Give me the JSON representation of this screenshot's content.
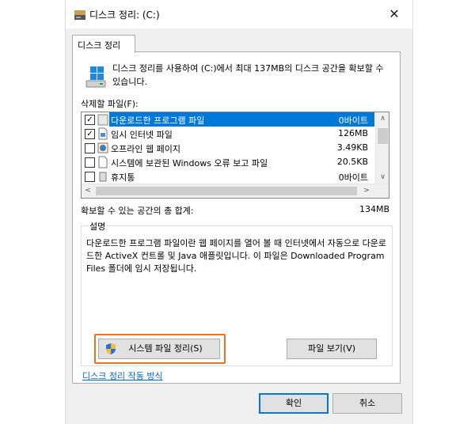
{
  "window": {
    "title": "디스크 정리: (C:)",
    "close_glyph": "✕"
  },
  "tab": {
    "label": "디스크 정리"
  },
  "intro_text": "디스크 정리를 사용하여 (C:)에서 최대 137MB의 디스크 공간을 확보할 수 있습니다.",
  "files_label": "삭제할 파일(F):",
  "files": [
    {
      "name": "다운로드한 프로그램 파일",
      "size": "0바이트",
      "checked": true,
      "selected": true,
      "icon": "folder-icon"
    },
    {
      "name": "임시 인터넷 파일",
      "size": "126MB",
      "checked": true,
      "selected": false,
      "icon": "file-icon"
    },
    {
      "name": "오프라인 웹 페이지",
      "size": "3.49KB",
      "checked": false,
      "selected": false,
      "icon": "offline-page-icon"
    },
    {
      "name": "시스템에 보관된 Windows 오류 보고 파일",
      "size": "20.5KB",
      "checked": false,
      "selected": false,
      "icon": "file-icon"
    },
    {
      "name": "휴지통",
      "size": "0바이트",
      "checked": false,
      "selected": false,
      "icon": "recycle-bin-icon"
    }
  ],
  "scroll": {
    "up": "∧",
    "down": "∨",
    "left": "<",
    "right": ">"
  },
  "total_label": "확보할 수 있는 공간의 총 합계:",
  "total_value": "134MB",
  "description": {
    "title": "설명",
    "text": "다운로드한 프로그램 파일이란 웹 페이지를 열어 볼 때 인터넷에서 자동으로 다운로드한 ActiveX 컨트롤 및 Java 애플릿입니다. 이 파일은 Downloaded Program Files 폴더에 임시 저장됩니다."
  },
  "buttons": {
    "cleanup_system": "시스템 파일 정리(S)",
    "view_files": "파일 보기(V)",
    "ok": "확인",
    "cancel": "취소"
  },
  "howto_link": "디스크 정리 작동 방식",
  "colors": {
    "selection": "#0078d7",
    "highlight": "#f07020",
    "link": "#0066cc"
  }
}
